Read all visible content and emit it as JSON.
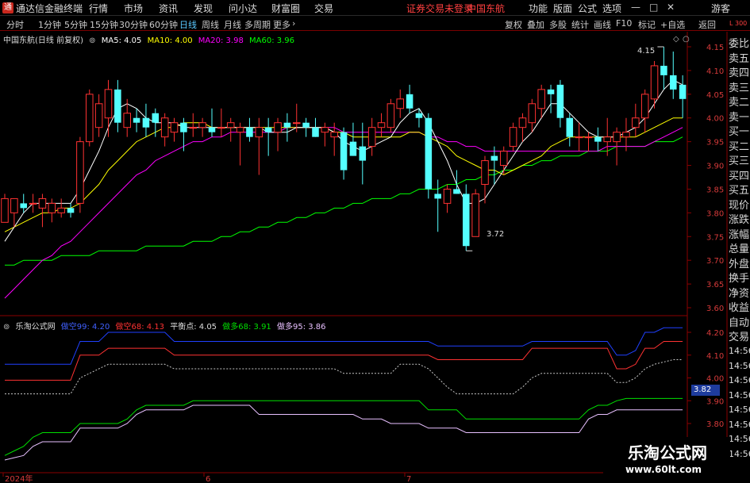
{
  "app": {
    "title": "通达信金融终端",
    "user": "游客"
  },
  "menu": {
    "items": [
      "行情",
      "市场",
      "资讯",
      "发现",
      "问小达",
      "财富圈",
      "交易"
    ],
    "notice": "证券交易未登录",
    "stock_link": "中国东航",
    "right": [
      "功能",
      "版面",
      "公式",
      "选项"
    ]
  },
  "toolbar": {
    "periods": [
      "分时",
      "1分钟",
      "5分钟",
      "15分钟",
      "30分钟",
      "60分钟",
      "日线",
      "周线",
      "月线",
      "多周期",
      "更多"
    ],
    "active_period": "日线",
    "right": [
      "复权",
      "叠加",
      "多股",
      "统计",
      "画线",
      "F10",
      "标记",
      "+自选",
      "返回"
    ]
  },
  "main_legend": {
    "name": "中国东航(日线 前复权)",
    "ma5": "MA5: 4.05",
    "ma10": "MA10: 4.00",
    "ma20": "MA20: 3.98",
    "ma60": "MA60: 3.96"
  },
  "sub_legend": {
    "name": "乐淘公式网",
    "kong99": "做空99: 4.20",
    "kong68": "做空68: 4.13",
    "balance": "平衡点: 4.05",
    "duo68": "做多68: 3.91",
    "duo95": "做多95: 3.86"
  },
  "annotations": {
    "high": "4.15",
    "low": "3.72",
    "tag": "3.82"
  },
  "price_axis": [
    "4.15",
    "4.10",
    "4.05",
    "4.00",
    "3.95",
    "3.90",
    "3.85",
    "3.80",
    "3.75",
    "3.70",
    "3.65",
    "3.60"
  ],
  "sub_axis": [
    "4.20",
    "4.10",
    "4.00",
    "3.90",
    "3.80",
    "3.70"
  ],
  "date_axis": [
    "2024年",
    "6",
    "7"
  ],
  "side_panel": [
    "委比",
    "卖五",
    "卖四",
    "卖三",
    "卖二",
    "卖一",
    "买一",
    "买二",
    "买三",
    "买四",
    "买五",
    "现价",
    "涨跌",
    "涨幅",
    "总量",
    "外盘",
    "换手",
    "净资",
    "收益",
    "自动",
    "交易",
    "14:56",
    "14:56",
    "14:56",
    "14:56",
    "14:56",
    "14:56",
    "14:56",
    "14:56"
  ],
  "corner_label": "L 300",
  "brand": {
    "name": "乐淘公式网",
    "url": "www.60lt.com"
  },
  "colors": {
    "up": "#ff3232",
    "down": "#54ffff",
    "ma5": "#ffffff",
    "ma10": "#ffff00",
    "ma20": "#ff00ff",
    "ma60": "#00ff00",
    "blue": "#2040ff",
    "red": "#ff3232",
    "green": "#00e000",
    "pink": "#e8c0ff",
    "dotted": "#c8c8c8"
  },
  "chart_data": {
    "type": "candlestick",
    "ylim": [
      3.58,
      4.17
    ],
    "candles": [
      {
        "o": 3.78,
        "h": 3.84,
        "l": 3.78,
        "c": 3.83
      },
      {
        "o": 3.8,
        "h": 3.83,
        "l": 3.77,
        "c": 3.83
      },
      {
        "o": 3.82,
        "h": 3.84,
        "l": 3.8,
        "c": 3.81
      },
      {
        "o": 3.82,
        "h": 3.84,
        "l": 3.8,
        "c": 3.82
      },
      {
        "o": 3.81,
        "h": 3.84,
        "l": 3.77,
        "c": 3.83
      },
      {
        "o": 3.8,
        "h": 3.83,
        "l": 3.78,
        "c": 3.82
      },
      {
        "o": 3.8,
        "h": 3.83,
        "l": 3.79,
        "c": 3.81
      },
      {
        "o": 3.81,
        "h": 3.82,
        "l": 3.79,
        "c": 3.8
      },
      {
        "o": 3.82,
        "h": 3.96,
        "l": 3.8,
        "c": 3.95
      },
      {
        "o": 3.95,
        "h": 4.06,
        "l": 3.94,
        "c": 4.05
      },
      {
        "o": 3.98,
        "h": 4.05,
        "l": 3.96,
        "c": 4.03
      },
      {
        "o": 4.0,
        "h": 4.08,
        "l": 3.96,
        "c": 4.06
      },
      {
        "o": 4.06,
        "h": 4.08,
        "l": 3.97,
        "c": 3.99
      },
      {
        "o": 3.98,
        "h": 4.04,
        "l": 3.96,
        "c": 4.01
      },
      {
        "o": 4.0,
        "h": 4.02,
        "l": 3.97,
        "c": 3.99
      },
      {
        "o": 4.0,
        "h": 4.03,
        "l": 3.96,
        "c": 3.98
      },
      {
        "o": 4.01,
        "h": 4.02,
        "l": 3.96,
        "c": 3.99
      },
      {
        "o": 3.96,
        "h": 4.01,
        "l": 3.94,
        "c": 4.0
      },
      {
        "o": 3.97,
        "h": 4.0,
        "l": 3.95,
        "c": 3.99
      },
      {
        "o": 3.99,
        "h": 4.0,
        "l": 3.93,
        "c": 3.97
      },
      {
        "o": 3.98,
        "h": 4.01,
        "l": 3.96,
        "c": 3.98
      },
      {
        "o": 3.98,
        "h": 4.0,
        "l": 3.96,
        "c": 3.99
      },
      {
        "o": 3.98,
        "h": 4.02,
        "l": 3.96,
        "c": 3.97
      },
      {
        "o": 3.98,
        "h": 4.02,
        "l": 3.96,
        "c": 3.98
      },
      {
        "o": 3.98,
        "h": 4.0,
        "l": 3.95,
        "c": 3.99
      },
      {
        "o": 3.97,
        "h": 3.99,
        "l": 3.9,
        "c": 3.98
      },
      {
        "o": 3.98,
        "h": 4.0,
        "l": 3.95,
        "c": 3.96
      },
      {
        "o": 3.96,
        "h": 4.0,
        "l": 3.88,
        "c": 3.98
      },
      {
        "o": 3.98,
        "h": 4.0,
        "l": 3.92,
        "c": 3.97
      },
      {
        "o": 3.97,
        "h": 4.0,
        "l": 3.93,
        "c": 3.99
      },
      {
        "o": 3.99,
        "h": 4.01,
        "l": 3.95,
        "c": 3.98
      },
      {
        "o": 3.99,
        "h": 4.03,
        "l": 3.97,
        "c": 3.99
      },
      {
        "o": 3.99,
        "h": 4.0,
        "l": 3.96,
        "c": 3.98
      },
      {
        "o": 3.98,
        "h": 4.0,
        "l": 3.96,
        "c": 3.96
      },
      {
        "o": 3.97,
        "h": 3.99,
        "l": 3.94,
        "c": 3.98
      },
      {
        "o": 3.96,
        "h": 3.99,
        "l": 3.92,
        "c": 3.97
      },
      {
        "o": 3.97,
        "h": 3.98,
        "l": 3.87,
        "c": 3.89
      },
      {
        "o": 3.95,
        "h": 3.99,
        "l": 3.92,
        "c": 3.92
      },
      {
        "o": 3.94,
        "h": 3.99,
        "l": 3.86,
        "c": 3.91
      },
      {
        "o": 3.94,
        "h": 4.0,
        "l": 3.92,
        "c": 3.98
      },
      {
        "o": 3.98,
        "h": 4.01,
        "l": 3.96,
        "c": 3.99
      },
      {
        "o": 3.98,
        "h": 4.04,
        "l": 3.97,
        "c": 4.03
      },
      {
        "o": 4.02,
        "h": 4.06,
        "l": 4.0,
        "c": 4.04
      },
      {
        "o": 4.05,
        "h": 4.07,
        "l": 4.01,
        "c": 4.02
      },
      {
        "o": 4.01,
        "h": 4.02,
        "l": 3.98,
        "c": 4.0
      },
      {
        "o": 4.0,
        "h": 4.01,
        "l": 3.83,
        "c": 3.85
      },
      {
        "o": 3.84,
        "h": 3.87,
        "l": 3.76,
        "c": 3.83
      },
      {
        "o": 3.82,
        "h": 3.86,
        "l": 3.8,
        "c": 3.85
      },
      {
        "o": 3.85,
        "h": 3.89,
        "l": 3.84,
        "c": 3.84
      },
      {
        "o": 3.84,
        "h": 3.86,
        "l": 3.72,
        "c": 3.73
      },
      {
        "o": 3.75,
        "h": 3.85,
        "l": 3.75,
        "c": 3.84
      },
      {
        "o": 3.86,
        "h": 3.92,
        "l": 3.82,
        "c": 3.91
      },
      {
        "o": 3.92,
        "h": 3.94,
        "l": 3.86,
        "c": 3.91
      },
      {
        "o": 3.9,
        "h": 3.94,
        "l": 3.88,
        "c": 3.93
      },
      {
        "o": 3.94,
        "h": 3.99,
        "l": 3.93,
        "c": 3.98
      },
      {
        "o": 3.98,
        "h": 4.01,
        "l": 3.95,
        "c": 4.0
      },
      {
        "o": 3.99,
        "h": 4.04,
        "l": 3.97,
        "c": 4.03
      },
      {
        "o": 4.02,
        "h": 4.07,
        "l": 4.0,
        "c": 4.06
      },
      {
        "o": 4.06,
        "h": 4.07,
        "l": 4.01,
        "c": 4.05
      },
      {
        "o": 4.07,
        "h": 4.08,
        "l": 3.98,
        "c": 4.0
      },
      {
        "o": 4.0,
        "h": 4.01,
        "l": 3.94,
        "c": 3.96
      },
      {
        "o": 3.96,
        "h": 3.99,
        "l": 3.93,
        "c": 3.96
      },
      {
        "o": 3.96,
        "h": 3.97,
        "l": 3.93,
        "c": 3.96
      },
      {
        "o": 3.96,
        "h": 3.98,
        "l": 3.93,
        "c": 3.95
      },
      {
        "o": 3.95,
        "h": 4.0,
        "l": 3.92,
        "c": 3.96
      },
      {
        "o": 3.95,
        "h": 3.98,
        "l": 3.9,
        "c": 3.97
      },
      {
        "o": 3.96,
        "h": 4.0,
        "l": 3.93,
        "c": 3.97
      },
      {
        "o": 3.98,
        "h": 4.03,
        "l": 3.96,
        "c": 4.0
      },
      {
        "o": 4.0,
        "h": 4.06,
        "l": 3.97,
        "c": 4.05
      },
      {
        "o": 4.04,
        "h": 4.12,
        "l": 4.02,
        "c": 4.11
      },
      {
        "o": 4.11,
        "h": 4.15,
        "l": 4.06,
        "c": 4.09
      },
      {
        "o": 4.09,
        "h": 4.14,
        "l": 4.04,
        "c": 4.06
      },
      {
        "o": 4.07,
        "h": 4.09,
        "l": 4.0,
        "c": 4.04
      }
    ],
    "ma": {
      "ma5": [
        3.74,
        3.77,
        3.8,
        3.82,
        3.82,
        3.82,
        3.82,
        3.82,
        3.85,
        3.89,
        3.93,
        3.98,
        4.02,
        4.03,
        4.02,
        4.0,
        3.99,
        3.99,
        3.99,
        3.98,
        3.98,
        3.98,
        3.98,
        3.98,
        3.98,
        3.98,
        3.98,
        3.98,
        3.97,
        3.97,
        3.97,
        3.98,
        3.98,
        3.98,
        3.98,
        3.97,
        3.95,
        3.94,
        3.93,
        3.94,
        3.95,
        3.96,
        3.99,
        4.01,
        4.02,
        3.99,
        3.95,
        3.91,
        3.86,
        3.82,
        3.82,
        3.83,
        3.86,
        3.89,
        3.92,
        3.95,
        3.97,
        4.0,
        4.03,
        4.03,
        4.01,
        3.99,
        3.97,
        3.96,
        3.96,
        3.96,
        3.97,
        3.98,
        4.0,
        4.03,
        4.06,
        4.08,
        4.07
      ],
      "ma10": [
        3.76,
        3.77,
        3.78,
        3.79,
        3.8,
        3.8,
        3.81,
        3.81,
        3.82,
        3.84,
        3.86,
        3.89,
        3.91,
        3.93,
        3.95,
        3.96,
        3.97,
        3.98,
        3.98,
        3.99,
        3.99,
        3.99,
        3.98,
        3.98,
        3.98,
        3.98,
        3.98,
        3.98,
        3.98,
        3.98,
        3.98,
        3.98,
        3.98,
        3.98,
        3.98,
        3.97,
        3.97,
        3.96,
        3.96,
        3.96,
        3.96,
        3.96,
        3.96,
        3.97,
        3.97,
        3.96,
        3.95,
        3.94,
        3.92,
        3.91,
        3.9,
        3.89,
        3.89,
        3.88,
        3.89,
        3.9,
        3.91,
        3.92,
        3.94,
        3.95,
        3.96,
        3.96,
        3.96,
        3.96,
        3.96,
        3.96,
        3.96,
        3.96,
        3.97,
        3.98,
        3.99,
        4.0,
        4.0
      ],
      "ma20": [
        3.62,
        3.64,
        3.66,
        3.68,
        3.7,
        3.71,
        3.73,
        3.74,
        3.76,
        3.78,
        3.8,
        3.82,
        3.84,
        3.86,
        3.88,
        3.89,
        3.91,
        3.92,
        3.93,
        3.94,
        3.95,
        3.95,
        3.96,
        3.96,
        3.97,
        3.97,
        3.97,
        3.97,
        3.97,
        3.97,
        3.98,
        3.98,
        3.98,
        3.98,
        3.98,
        3.98,
        3.97,
        3.97,
        3.97,
        3.97,
        3.97,
        3.97,
        3.97,
        3.97,
        3.97,
        3.96,
        3.96,
        3.95,
        3.95,
        3.94,
        3.94,
        3.93,
        3.93,
        3.93,
        3.93,
        3.93,
        3.93,
        3.93,
        3.93,
        3.93,
        3.93,
        3.93,
        3.93,
        3.93,
        3.94,
        3.94,
        3.94,
        3.94,
        3.94,
        3.95,
        3.96,
        3.97,
        3.98
      ],
      "ma60": [
        3.69,
        3.69,
        3.7,
        3.7,
        3.7,
        3.7,
        3.71,
        3.71,
        3.71,
        3.71,
        3.72,
        3.72,
        3.72,
        3.72,
        3.72,
        3.73,
        3.73,
        3.73,
        3.73,
        3.73,
        3.74,
        3.74,
        3.74,
        3.75,
        3.75,
        3.76,
        3.76,
        3.77,
        3.77,
        3.78,
        3.78,
        3.79,
        3.79,
        3.8,
        3.8,
        3.81,
        3.81,
        3.82,
        3.82,
        3.83,
        3.83,
        3.83,
        3.84,
        3.84,
        3.85,
        3.85,
        3.85,
        3.86,
        3.86,
        3.87,
        3.87,
        3.88,
        3.88,
        3.89,
        3.89,
        3.9,
        3.9,
        3.91,
        3.91,
        3.92,
        3.92,
        3.92,
        3.93,
        3.93,
        3.93,
        3.94,
        3.94,
        3.94,
        3.94,
        3.95,
        3.95,
        3.95,
        3.96
      ]
    },
    "sub": {
      "ylim": [
        3.64,
        4.24
      ],
      "kong99": [
        4.06,
        4.06,
        4.06,
        4.06,
        4.06,
        4.06,
        4.06,
        4.06,
        4.16,
        4.16,
        4.16,
        4.2,
        4.2,
        4.2,
        4.2,
        4.2,
        4.2,
        4.2,
        4.16,
        4.16,
        4.16,
        4.16,
        4.16,
        4.16,
        4.16,
        4.16,
        4.16,
        4.16,
        4.16,
        4.16,
        4.16,
        4.16,
        4.16,
        4.16,
        4.16,
        4.16,
        4.16,
        4.16,
        4.16,
        4.16,
        4.16,
        4.16,
        4.16,
        4.16,
        4.16,
        4.16,
        4.14,
        4.14,
        4.14,
        4.14,
        4.14,
        4.14,
        4.14,
        4.14,
        4.14,
        4.14,
        4.16,
        4.16,
        4.16,
        4.16,
        4.16,
        4.16,
        4.16,
        4.16,
        4.16,
        4.1,
        4.1,
        4.12,
        4.2,
        4.2,
        4.22,
        4.22,
        4.22
      ],
      "kong68": [
        3.99,
        3.99,
        3.99,
        3.99,
        3.99,
        3.99,
        3.99,
        3.99,
        4.1,
        4.1,
        4.1,
        4.13,
        4.13,
        4.13,
        4.13,
        4.13,
        4.13,
        4.13,
        4.1,
        4.1,
        4.1,
        4.1,
        4.1,
        4.1,
        4.1,
        4.1,
        4.1,
        4.1,
        4.1,
        4.1,
        4.1,
        4.1,
        4.1,
        4.1,
        4.1,
        4.1,
        4.1,
        4.1,
        4.1,
        4.1,
        4.1,
        4.1,
        4.1,
        4.1,
        4.1,
        4.1,
        4.08,
        4.08,
        4.08,
        4.08,
        4.08,
        4.08,
        4.08,
        4.08,
        4.08,
        4.08,
        4.13,
        4.13,
        4.13,
        4.13,
        4.13,
        4.13,
        4.13,
        4.13,
        4.13,
        4.04,
        4.04,
        4.06,
        4.13,
        4.13,
        4.16,
        4.16,
        4.16
      ],
      "balance": [
        3.93,
        3.93,
        3.93,
        3.93,
        3.93,
        3.93,
        3.93,
        3.93,
        4.0,
        4.02,
        4.04,
        4.06,
        4.06,
        4.06,
        4.06,
        4.06,
        4.06,
        4.06,
        4.04,
        4.04,
        4.04,
        4.04,
        4.04,
        4.04,
        4.04,
        4.04,
        4.04,
        4.04,
        4.04,
        4.04,
        4.04,
        4.04,
        4.04,
        4.04,
        4.04,
        4.04,
        4.02,
        4.02,
        4.02,
        4.02,
        4.02,
        4.02,
        4.06,
        4.06,
        4.06,
        4.04,
        4.0,
        3.96,
        3.93,
        3.93,
        3.93,
        3.93,
        3.93,
        3.93,
        3.93,
        3.96,
        4.0,
        4.02,
        4.02,
        4.02,
        4.02,
        4.02,
        4.02,
        4.02,
        4.02,
        3.98,
        3.98,
        4.0,
        4.04,
        4.06,
        4.07,
        4.08,
        4.08
      ],
      "duo68": [
        3.66,
        3.68,
        3.7,
        3.74,
        3.76,
        3.76,
        3.76,
        3.76,
        3.8,
        3.8,
        3.8,
        3.8,
        3.8,
        3.82,
        3.86,
        3.88,
        3.88,
        3.88,
        3.88,
        3.88,
        3.9,
        3.9,
        3.9,
        3.9,
        3.9,
        3.9,
        3.9,
        3.9,
        3.9,
        3.9,
        3.9,
        3.9,
        3.9,
        3.9,
        3.9,
        3.9,
        3.9,
        3.9,
        3.9,
        3.9,
        3.9,
        3.9,
        3.9,
        3.9,
        3.9,
        3.86,
        3.86,
        3.86,
        3.86,
        3.82,
        3.82,
        3.82,
        3.82,
        3.82,
        3.82,
        3.82,
        3.82,
        3.82,
        3.82,
        3.82,
        3.82,
        3.82,
        3.86,
        3.88,
        3.88,
        3.9,
        3.91,
        3.91,
        3.91,
        3.91,
        3.91,
        3.91,
        3.91
      ],
      "duo95": [
        3.64,
        3.65,
        3.66,
        3.7,
        3.72,
        3.72,
        3.72,
        3.72,
        3.78,
        3.78,
        3.78,
        3.78,
        3.78,
        3.8,
        3.84,
        3.86,
        3.86,
        3.86,
        3.86,
        3.86,
        3.88,
        3.88,
        3.88,
        3.88,
        3.88,
        3.88,
        3.88,
        3.84,
        3.84,
        3.84,
        3.84,
        3.84,
        3.84,
        3.84,
        3.84,
        3.84,
        3.84,
        3.84,
        3.82,
        3.82,
        3.82,
        3.8,
        3.8,
        3.8,
        3.8,
        3.78,
        3.78,
        3.78,
        3.78,
        3.76,
        3.76,
        3.76,
        3.76,
        3.76,
        3.76,
        3.76,
        3.76,
        3.76,
        3.76,
        3.76,
        3.76,
        3.76,
        3.82,
        3.84,
        3.84,
        3.86,
        3.86,
        3.86,
        3.86,
        3.86,
        3.86,
        3.86,
        3.86
      ]
    }
  }
}
